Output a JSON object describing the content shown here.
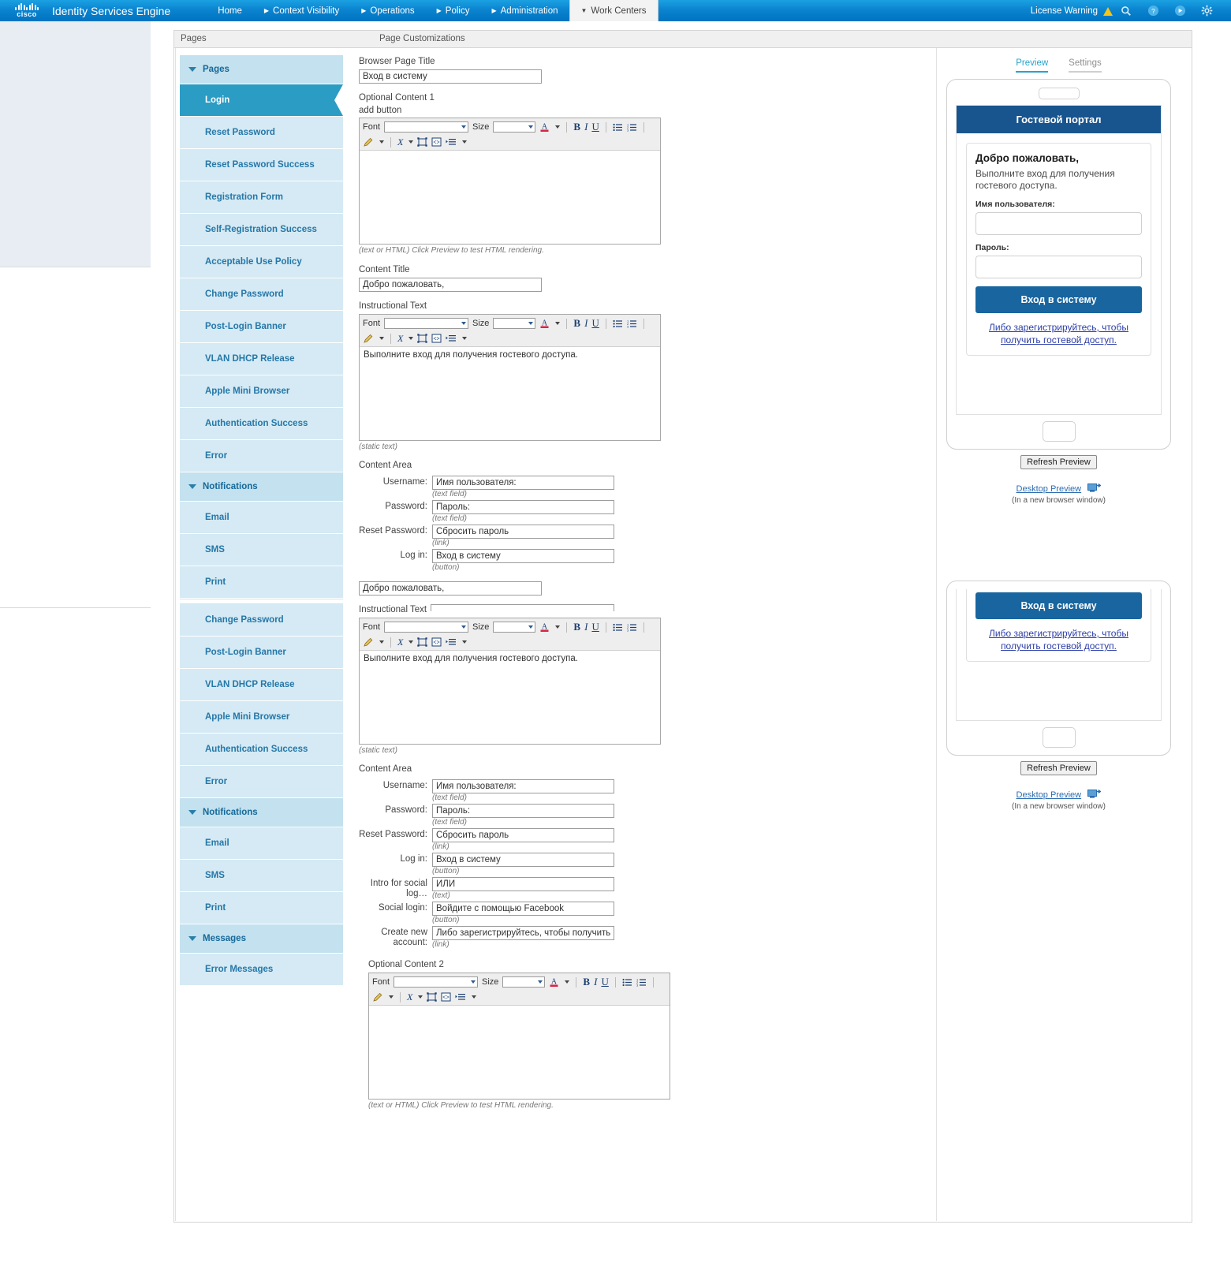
{
  "topnav": {
    "brand": "Identity Services Engine",
    "cisco_wordmark": "cisco",
    "items": [
      {
        "label": "Home",
        "has_arrow": false,
        "active": false
      },
      {
        "label": "Context Visibility",
        "has_arrow": true,
        "active": false
      },
      {
        "label": "Operations",
        "has_arrow": true,
        "active": false
      },
      {
        "label": "Policy",
        "has_arrow": true,
        "active": false
      },
      {
        "label": "Administration",
        "has_arrow": true,
        "active": false
      },
      {
        "label": "Work Centers",
        "has_arrow": true,
        "active": true
      }
    ],
    "license_warning": "License Warning",
    "icons": [
      "warning-triangle-icon",
      "search-icon",
      "help-icon",
      "notification-icon",
      "gear-icon"
    ]
  },
  "frame": {
    "pages_header": "Pages",
    "customizations_header": "Page Customizations"
  },
  "sidebar": [
    {
      "type": "group",
      "label": "Pages"
    },
    {
      "type": "item",
      "label": "Login",
      "active": true
    },
    {
      "type": "item",
      "label": "Reset Password",
      "active": false
    },
    {
      "type": "item",
      "label": "Reset Password Success",
      "active": false
    },
    {
      "type": "item",
      "label": "Registration Form",
      "active": false
    },
    {
      "type": "item",
      "label": "Self-Registration Success",
      "active": false
    },
    {
      "type": "item",
      "label": "Acceptable Use Policy",
      "active": false
    },
    {
      "type": "item",
      "label": "Change Password",
      "active": false
    },
    {
      "type": "item",
      "label": "Post-Login Banner",
      "active": false
    },
    {
      "type": "item",
      "label": "VLAN DHCP Release",
      "active": false
    },
    {
      "type": "item",
      "label": "Apple Mini Browser",
      "active": false
    },
    {
      "type": "item",
      "label": "Authentication Success",
      "active": false
    },
    {
      "type": "item",
      "label": "Error",
      "active": false
    },
    {
      "type": "group",
      "label": "Notifications"
    },
    {
      "type": "item",
      "label": "Email",
      "active": false
    },
    {
      "type": "item",
      "label": "SMS",
      "active": false
    },
    {
      "type": "item",
      "label": "Print",
      "active": false
    },
    {
      "type": "separator"
    },
    {
      "type": "item",
      "label": "Change Password",
      "active": false
    },
    {
      "type": "item",
      "label": "Post-Login Banner",
      "active": false
    },
    {
      "type": "item",
      "label": "VLAN DHCP Release",
      "active": false
    },
    {
      "type": "item",
      "label": "Apple Mini Browser",
      "active": false
    },
    {
      "type": "item",
      "label": "Authentication Success",
      "active": false
    },
    {
      "type": "item",
      "label": "Error",
      "active": false
    },
    {
      "type": "group",
      "label": "Notifications"
    },
    {
      "type": "item",
      "label": "Email",
      "active": false
    },
    {
      "type": "item",
      "label": "SMS",
      "active": false
    },
    {
      "type": "item",
      "label": "Print",
      "active": false
    },
    {
      "type": "group",
      "label": "Messages"
    },
    {
      "type": "item",
      "label": "Error Messages",
      "active": false
    }
  ],
  "editor_toolbar": {
    "font_label": "Font",
    "size_label": "Size",
    "buttons": [
      "text-color-icon",
      "bold-icon",
      "italic-icon",
      "underline-icon",
      "unordered-list-icon",
      "ordered-list-icon",
      "pencil-icon",
      "remove-format-icon",
      "select-all-icon",
      "source-code-icon",
      "indent-icon"
    ]
  },
  "main": {
    "browser_page_title_label": "Browser Page Title",
    "browser_page_title_value": "Вход в систему",
    "optional_content_1_label": "Optional Content 1",
    "add_button_label": "add button",
    "optional_content_1_value": "",
    "html_hint": "(text or HTML) Click Preview to test HTML rendering.",
    "content_title_label": "Content Title",
    "content_title_value": "Добро пожаловать,",
    "instructional_text_label": "Instructional Text",
    "instructional_text_value": "Выполните вход для получения гостевого доступа.",
    "static_text_hint": "(static text)",
    "content_area_label": "Content Area",
    "content_area_rows_1": [
      {
        "label": "Username:",
        "value": "Имя пользователя:",
        "hint": "(text field)"
      },
      {
        "label": "Password:",
        "value": "Пароль:",
        "hint": "(text field)"
      },
      {
        "label": "Reset Password:",
        "value": "Сбросить пароль",
        "hint": "(link)"
      },
      {
        "label": "Log in:",
        "value": "Вход в систему",
        "hint": "(button)"
      }
    ],
    "content_title_value_2": "Добро пожаловать,",
    "instructional_text_label_2": "Instructional Text",
    "instructional_text_value_2": "Выполните вход для получения гостевого доступа.",
    "content_area_label_2": "Content Area",
    "content_area_rows_2": [
      {
        "label": "Username:",
        "value": "Имя пользователя:",
        "hint": "(text field)"
      },
      {
        "label": "Password:",
        "value": "Пароль:",
        "hint": "(text field)"
      },
      {
        "label": "Reset Password:",
        "value": "Сбросить пароль",
        "hint": "(link)"
      },
      {
        "label": "Log in:",
        "value": "Вход в систему",
        "hint": "(button)"
      },
      {
        "label": "Intro for social log…",
        "value": "ИЛИ",
        "hint": "(text)"
      },
      {
        "label": "Social login:",
        "value": "Войдите с помощью Facebook",
        "hint": "(button)"
      },
      {
        "label": "Create new account:",
        "value": "Либо зарегистрируйтесь, чтобы получить гостевой",
        "hint": "(link)"
      }
    ],
    "optional_content_2_label": "Optional Content 2",
    "optional_content_2_value": "",
    "html_hint_2": "(text or HTML) Click Preview to test HTML rendering."
  },
  "preview": {
    "tab_preview": "Preview",
    "tab_settings": "Settings",
    "banner": "Гостевой портал",
    "title": "Добро пожаловать,",
    "instruction": "Выполните вход для получения гостевого доступа.",
    "username_label": "Имя пользователя:",
    "password_label": "Пароль:",
    "login_button": "Вход в систему",
    "register_link": "Либо зарегистрируйтесь, чтобы получить гостевой доступ.",
    "refresh_button": "Refresh Preview",
    "desktop_preview_link": "Desktop Preview",
    "desktop_preview_note": "(In a new browser window)"
  },
  "colors": {
    "nav_blue": "#0b84d0",
    "sidebar_active": "#2b9cc4",
    "sidebar_item": "#d5eaf4",
    "sidebar_group": "#c3e1ee",
    "preview_banner": "#18558f",
    "preview_button": "#18659f",
    "warning_yellow": "#f5c518"
  }
}
